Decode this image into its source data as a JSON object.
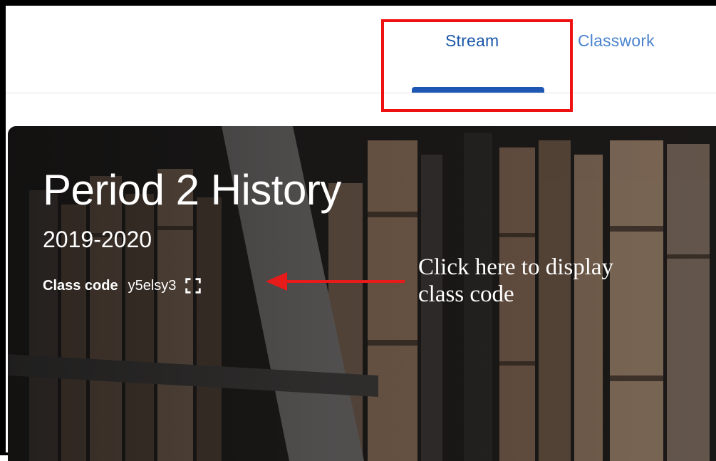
{
  "tabs": [
    {
      "label": "Stream",
      "active": true
    },
    {
      "label": "Classwork",
      "active": false
    }
  ],
  "class": {
    "title": "Period 2 History",
    "subtitle": "2019-2020",
    "code_label": "Class code",
    "code_value": "y5elsy3"
  },
  "annotation": {
    "line1": "Click here to display",
    "line2": "class code"
  },
  "icons": {
    "expand": "fullscreen-icon",
    "arrow": "arrow-left-icon"
  },
  "colors": {
    "tab_active": "#1a57a8",
    "tab_inactive": "#4b83cc",
    "highlight": "#ee1111",
    "annotation_arrow": "#e81b1b"
  }
}
